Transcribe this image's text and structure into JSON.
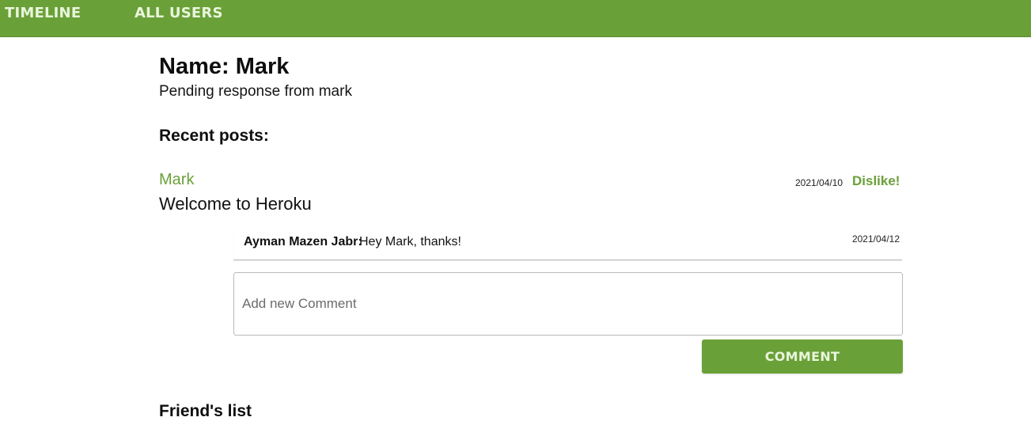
{
  "nav": {
    "timeline": "TIMELINE",
    "all_users": "ALL USERS"
  },
  "profile": {
    "name_heading": "Name: Mark",
    "status": "Pending response from mark"
  },
  "recent_posts": {
    "title": "Recent posts:",
    "posts": [
      {
        "author": "Mark",
        "date": "2021/04/10",
        "reaction_label": "Dislike!",
        "content": "Welcome to Heroku",
        "comments": [
          {
            "author": "Ayman Mazen Jabr:",
            "text": "Hey Mark, thanks!",
            "date": "2021/04/12"
          }
        ],
        "new_comment_placeholder": "Add new Comment",
        "comment_button": "COMMENT"
      }
    ]
  },
  "friends": {
    "title": "Friend's list"
  },
  "colors": {
    "brand_green": "#6aa038",
    "nav_text": "#e9f5dc"
  }
}
